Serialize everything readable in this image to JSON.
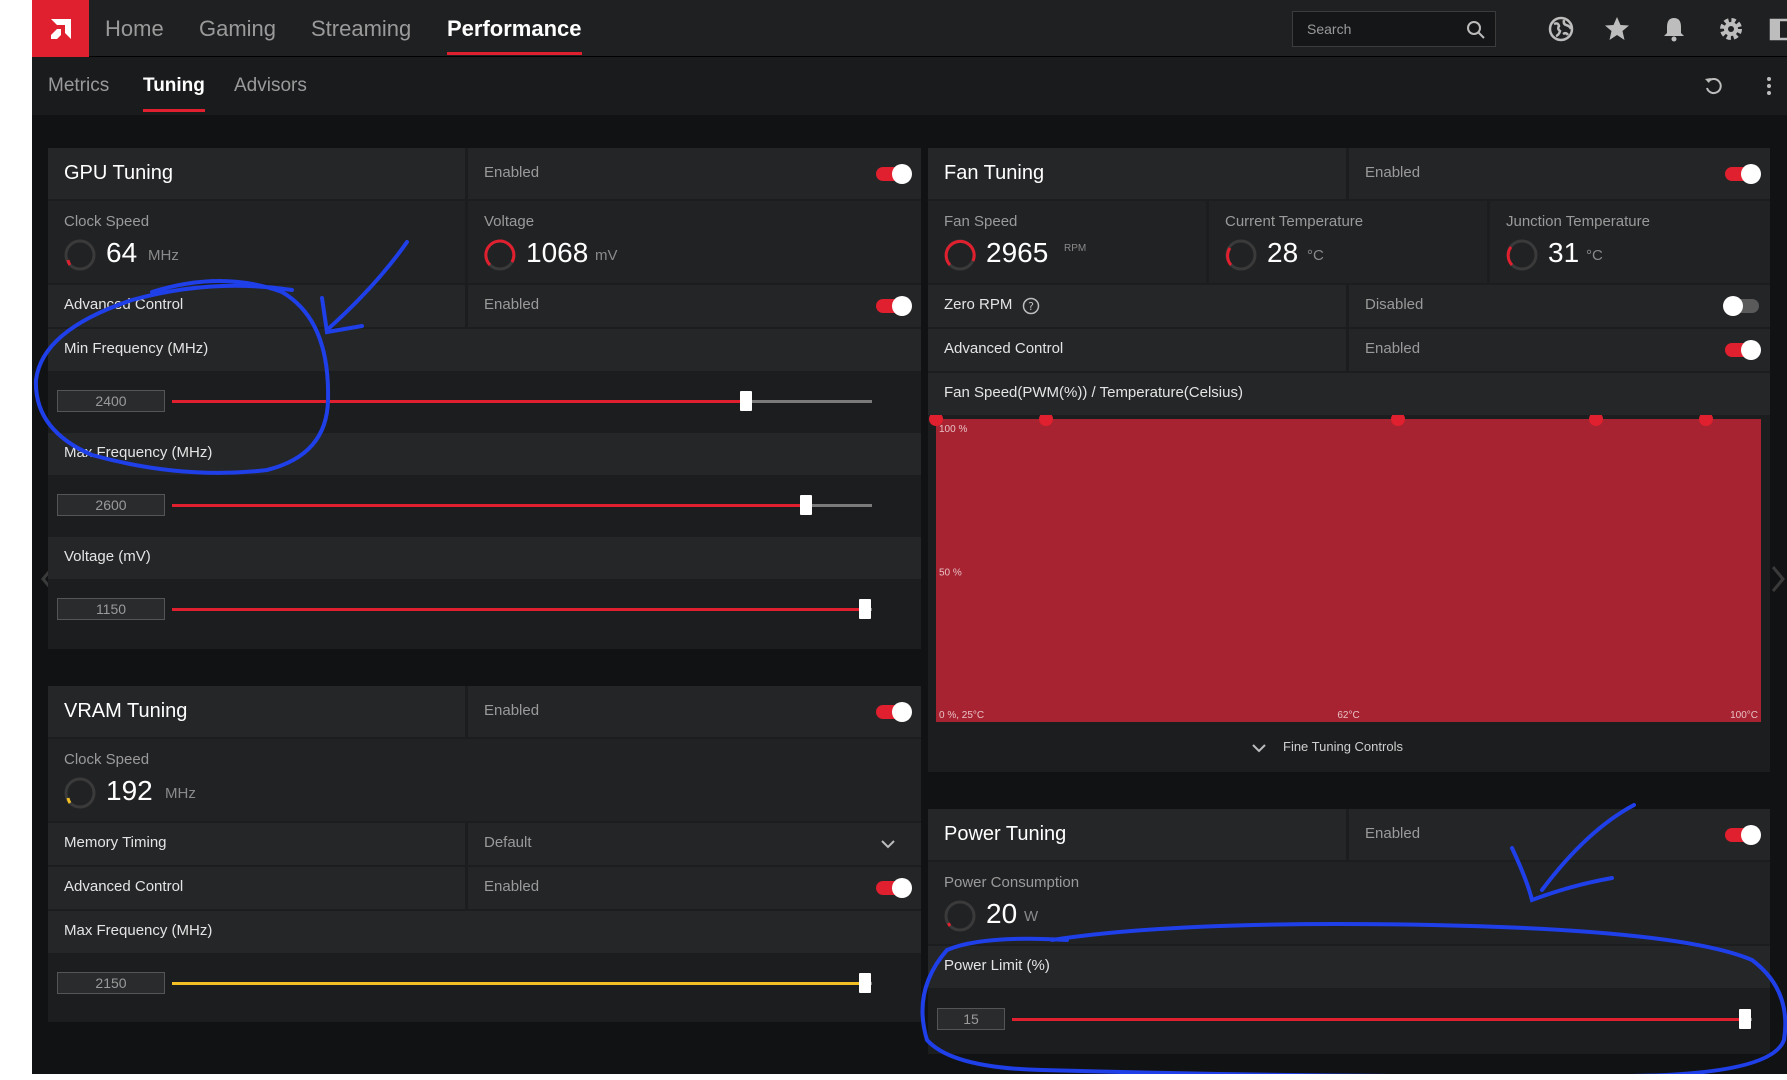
{
  "nav": {
    "tabs": [
      "Home",
      "Gaming",
      "Streaming",
      "Performance"
    ],
    "active": "Performance"
  },
  "search": {
    "placeholder": "Search"
  },
  "subnav": {
    "tabs": [
      "Metrics",
      "Tuning",
      "Advisors"
    ],
    "active": "Tuning"
  },
  "colors": {
    "accent": "#e0202e",
    "vram_slider": "#f2c025"
  },
  "gpu_tuning": {
    "title": "GPU Tuning",
    "status": "Enabled",
    "toggle_on": true,
    "clock_speed": {
      "label": "Clock Speed",
      "value": "64",
      "unit": "MHz"
    },
    "voltage": {
      "label": "Voltage",
      "value": "1068",
      "unit": "mV"
    },
    "advanced_control": {
      "label": "Advanced Control",
      "status": "Enabled",
      "toggle_on": true
    },
    "min_frequency": {
      "label": "Min Frequency (MHz)",
      "value": "2400",
      "slider_fraction": 0.82
    },
    "max_frequency": {
      "label": "Max Frequency (MHz)",
      "value": "2600",
      "slider_fraction": 0.905
    },
    "voltage_mv": {
      "label": "Voltage (mV)",
      "value": "1150",
      "slider_fraction": 0.99
    }
  },
  "vram_tuning": {
    "title": "VRAM Tuning",
    "status": "Enabled",
    "toggle_on": true,
    "clock_speed": {
      "label": "Clock Speed",
      "value": "192",
      "unit": "MHz"
    },
    "memory_timing": {
      "label": "Memory Timing",
      "value": "Default"
    },
    "advanced_control": {
      "label": "Advanced Control",
      "status": "Enabled",
      "toggle_on": true
    },
    "max_frequency": {
      "label": "Max Frequency (MHz)",
      "value": "2150",
      "slider_fraction": 0.99
    }
  },
  "fan_tuning": {
    "title": "Fan Tuning",
    "status": "Enabled",
    "toggle_on": true,
    "fan_speed": {
      "label": "Fan Speed",
      "value": "2965",
      "unit": "RPM"
    },
    "current_temperature": {
      "label": "Current Temperature",
      "value": "28",
      "unit": "°C"
    },
    "junction_temperature": {
      "label": "Junction Temperature",
      "value": "31",
      "unit": "°C"
    },
    "zero_rpm": {
      "label": "Zero RPM",
      "status": "Disabled",
      "toggle_on": false
    },
    "advanced_control": {
      "label": "Advanced Control",
      "status": "Enabled",
      "toggle_on": true
    },
    "chart_title": "Fan Speed(PWM(%)) / Temperature(Celsius)",
    "fine_tuning": "Fine Tuning Controls"
  },
  "chart_data": {
    "type": "area",
    "title": "Fan Speed(PWM(%)) / Temperature(Celsius)",
    "y_tick_labels": [
      "100 %",
      "50 %"
    ],
    "x_tick_labels": [
      "0 %, 25°C",
      "62°C",
      "100°C"
    ],
    "xlim": [
      25,
      100
    ],
    "ylim": [
      0,
      100
    ],
    "grid": true,
    "series": [
      {
        "x": [
          25,
          35,
          67,
          85,
          95
        ],
        "y": [
          100,
          100,
          100,
          100,
          100
        ]
      }
    ]
  },
  "power_tuning": {
    "title": "Power Tuning",
    "status": "Enabled",
    "toggle_on": true,
    "power_consumption": {
      "label": "Power Consumption",
      "value": "20",
      "unit": "W"
    },
    "power_limit": {
      "label": "Power Limit (%)",
      "value": "15",
      "slider_fraction": 0.99
    }
  }
}
